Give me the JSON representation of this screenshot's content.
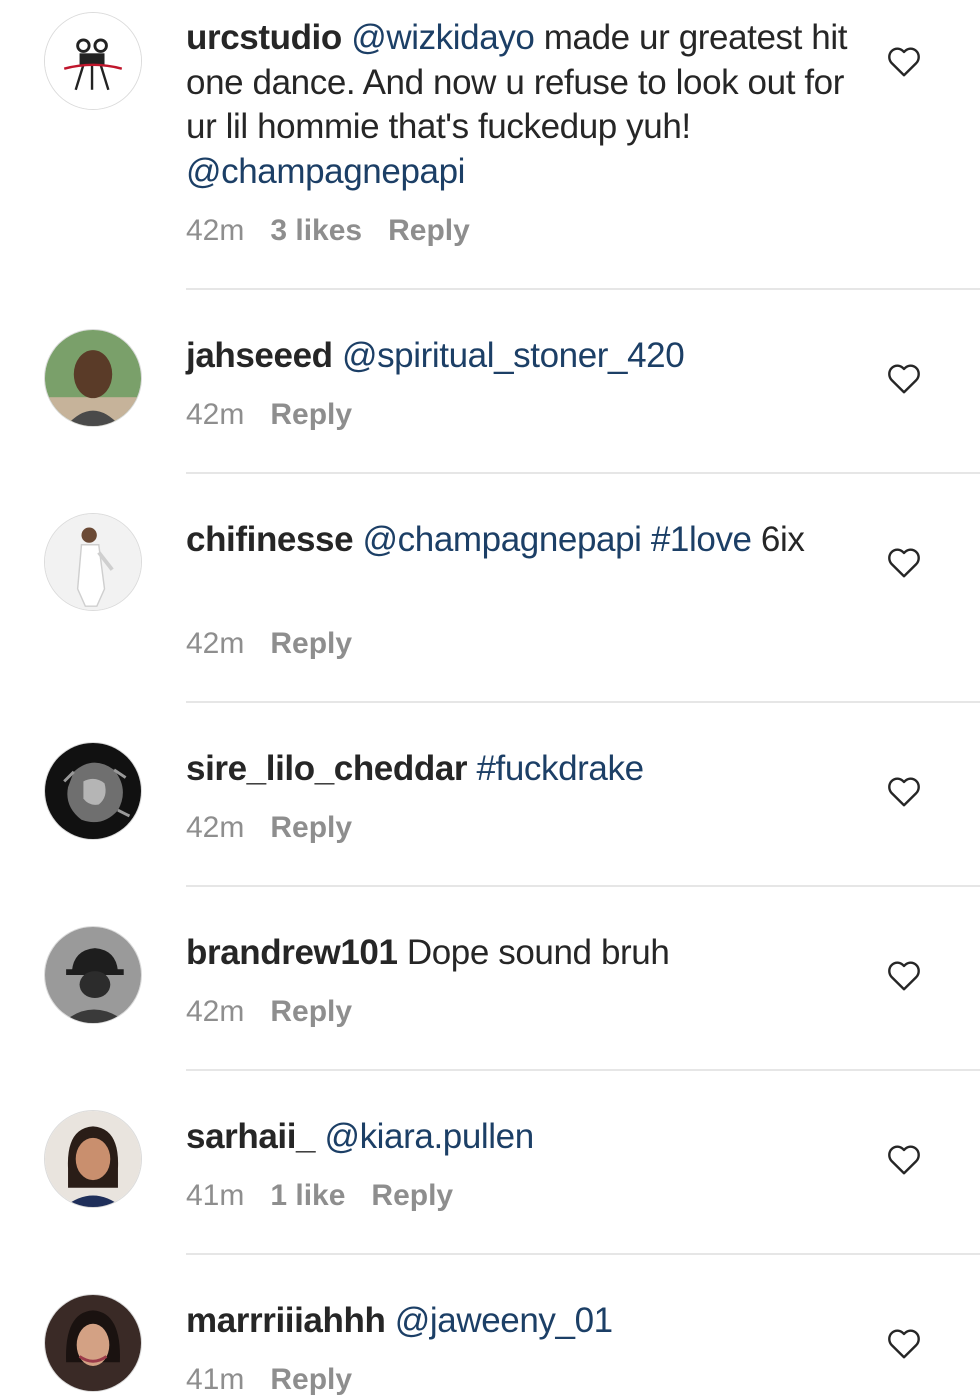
{
  "comments": [
    {
      "username": "urcstudio",
      "parts": [
        {
          "type": "mention",
          "text": "@wizkidayo"
        },
        {
          "type": "text",
          "text": " made ur greatest hit one dance. And now u refuse to look out for ur lil hommie that's fuckedup yuh! "
        },
        {
          "type": "mention",
          "text": "@champagnepapi"
        }
      ],
      "time": "42m",
      "likes": "3 likes",
      "reply": "Reply",
      "avatar": "studio-logo"
    },
    {
      "username": "jahseeed",
      "parts": [
        {
          "type": "mention",
          "text": "@spiritual_stoner_420"
        }
      ],
      "time": "42m",
      "likes": "",
      "reply": "Reply",
      "avatar": "man-selfie"
    },
    {
      "username": "chifinesse",
      "parts": [
        {
          "type": "mention",
          "text": "@champagnepapi #1love"
        },
        {
          "type": "text",
          "text": " 6ix"
        }
      ],
      "time": "42m",
      "likes": "",
      "reply": "Reply",
      "avatar": "person-white-outfit"
    },
    {
      "username": "sire_lilo_cheddar",
      "parts": [
        {
          "type": "mention",
          "text": "#fuckdrake"
        }
      ],
      "time": "42m",
      "likes": "",
      "reply": "Reply",
      "avatar": "lion"
    },
    {
      "username": "brandrew101",
      "parts": [
        {
          "type": "text",
          "text": "Dope sound bruh"
        }
      ],
      "time": "42m",
      "likes": "",
      "reply": "Reply",
      "avatar": "person-cap"
    },
    {
      "username": "sarhaii_",
      "parts": [
        {
          "type": "mention",
          "text": "@kiara.pullen"
        }
      ],
      "time": "41m",
      "likes": "1 like",
      "reply": "Reply",
      "avatar": "woman-portrait"
    },
    {
      "username": "marrriiiahhh",
      "parts": [
        {
          "type": "mention",
          "text": "@jaweeny_01"
        }
      ],
      "time": "41m",
      "likes": "",
      "reply": "Reply",
      "avatar": "woman-portrait-dark"
    }
  ],
  "icons": {
    "like": "heart-outline-icon"
  },
  "colors": {
    "mention": "#1c3f66",
    "meta": "#8e8e8e",
    "text": "#262626"
  }
}
